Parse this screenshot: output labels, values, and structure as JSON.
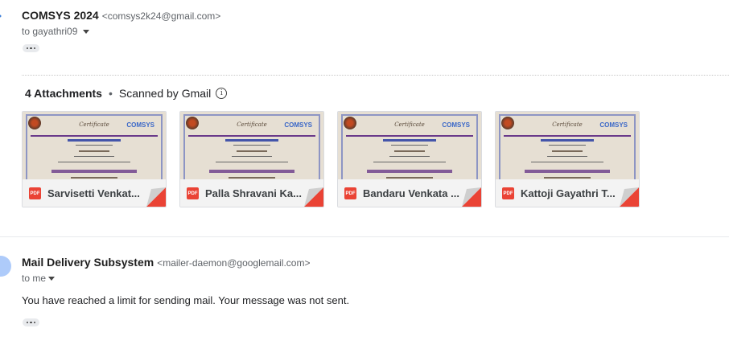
{
  "message1": {
    "sender_name": "COMSYS 2024",
    "sender_email": "<comsys2k24@gmail.com>",
    "to_line": "to gayathri09",
    "more_dots": "•••"
  },
  "attachments": {
    "count_label": "4 Attachments",
    "separator": "•",
    "scan_label": "Scanned by Gmail",
    "info_icon": "info-icon",
    "pdf_badge": "PDF",
    "thumbnail_logo": "COMSYS",
    "thumbnail_script": "Certificate",
    "items": [
      {
        "name": "Sarvisetti Venkat..."
      },
      {
        "name": "Palla Shravani Ka..."
      },
      {
        "name": "Bandaru Venkata ..."
      },
      {
        "name": "Kattoji Gayathri T..."
      }
    ]
  },
  "message2": {
    "sender_name": "Mail Delivery Subsystem",
    "sender_email": "<mailer-daemon@googlemail.com>",
    "to_line": "to me",
    "body": "You have reached a limit for sending mail. Your message was not sent.",
    "more_dots": "•••"
  },
  "colors": {
    "pdf_red": "#ea4335",
    "avatar_blue": "#aecbfa",
    "fold_red": "#ea4335"
  }
}
